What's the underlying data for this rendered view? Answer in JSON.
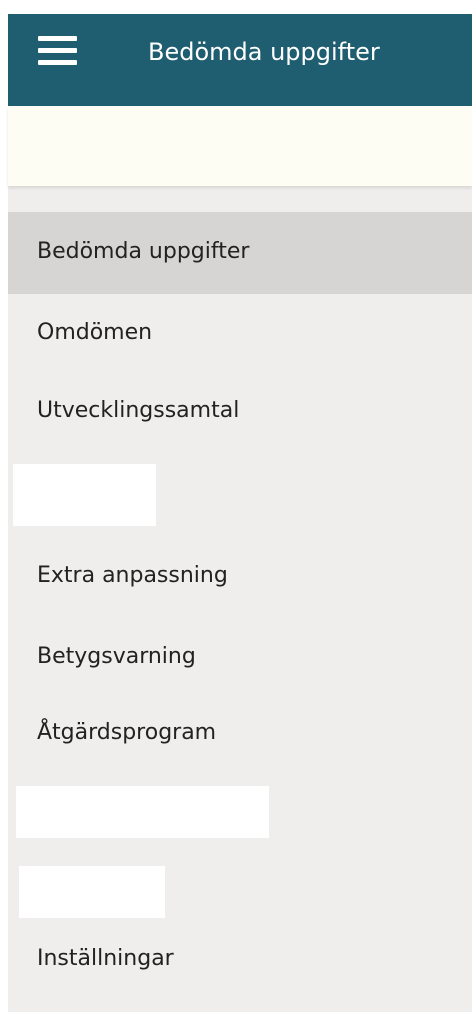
{
  "header": {
    "menu_icon": "hamburger-menu-icon",
    "title": "Bedömda uppgifter"
  },
  "nav": {
    "items": [
      {
        "label": "Bedömda uppgifter",
        "active": true
      },
      {
        "label": "Omdömen",
        "active": false
      },
      {
        "label": "Utvecklingssamtal",
        "active": false
      },
      {
        "label": "Extra anpassning",
        "active": false
      },
      {
        "label": "Betygsvarning",
        "active": false
      },
      {
        "label": "Åtgärdsprogram",
        "active": false
      },
      {
        "label": "Inställningar",
        "active": false
      }
    ]
  },
  "colors": {
    "header_bg": "#1f5d70",
    "subbar_bg": "#fdfdf3",
    "nav_bg": "#efeeec",
    "nav_active_bg": "#d6d5d3"
  }
}
